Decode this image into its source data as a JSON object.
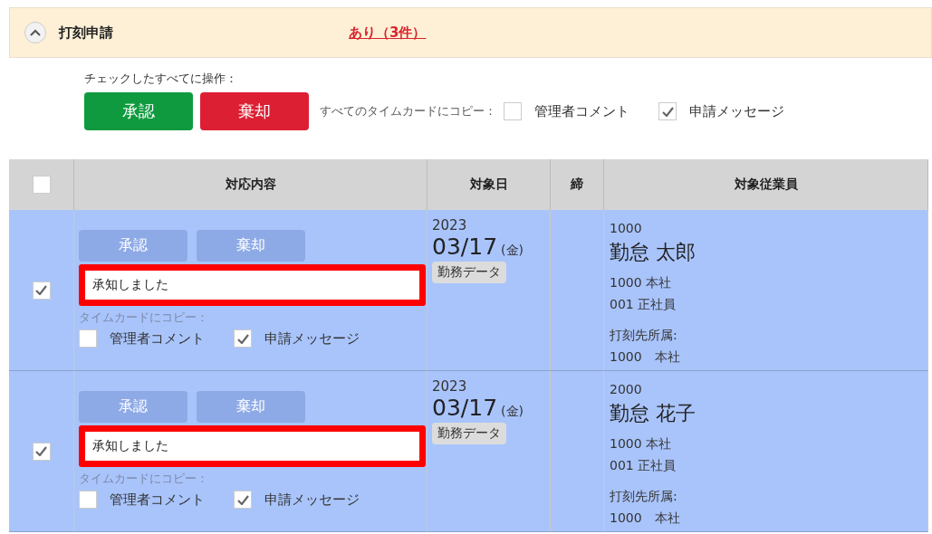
{
  "section": {
    "title": "打刻申請",
    "expanded": true,
    "status_link": "あり（3件）"
  },
  "bulk": {
    "label": "チェックしたすべてに操作：",
    "approve": "承認",
    "reject": "棄却",
    "copy_label": "すべてのタイムカードにコピー：",
    "copy_options": [
      {
        "label": "管理者コメント",
        "checked": false
      },
      {
        "label": "申請メッセージ",
        "checked": true
      }
    ]
  },
  "table": {
    "select_all": {
      "checked": false
    },
    "columns": [
      "対応内容",
      "対象日",
      "締",
      "対象従業員"
    ],
    "rows": [
      {
        "checked": true,
        "approve": "承認",
        "reject": "棄却",
        "comment": "承知しました",
        "copy_label": "タイムカードにコピー：",
        "copy_options": [
          {
            "label": "管理者コメント",
            "checked": false
          },
          {
            "label": "申請メッセージ",
            "checked": true
          }
        ],
        "year": "2023",
        "date": "03/17",
        "weekday": "(金)",
        "tag": "勤務データ",
        "employee_code": "1000",
        "employee_name": "勤怠 太郎",
        "department": "1000 本社",
        "employment_type": "001 正社員",
        "punch_label": "打刻先所属:",
        "punch_department": "1000　本社"
      },
      {
        "checked": true,
        "approve": "承認",
        "reject": "棄却",
        "comment": "承知しました",
        "copy_label": "タイムカードにコピー：",
        "copy_options": [
          {
            "label": "管理者コメント",
            "checked": false
          },
          {
            "label": "申請メッセージ",
            "checked": true
          }
        ],
        "year": "2023",
        "date": "03/17",
        "weekday": "(金)",
        "tag": "勤務データ",
        "employee_code": "2000",
        "employee_name": "勤怠 花子",
        "department": "1000 本社",
        "employment_type": "001 正社員",
        "punch_label": "打刻先所属:",
        "punch_department": "1000　本社"
      }
    ]
  }
}
